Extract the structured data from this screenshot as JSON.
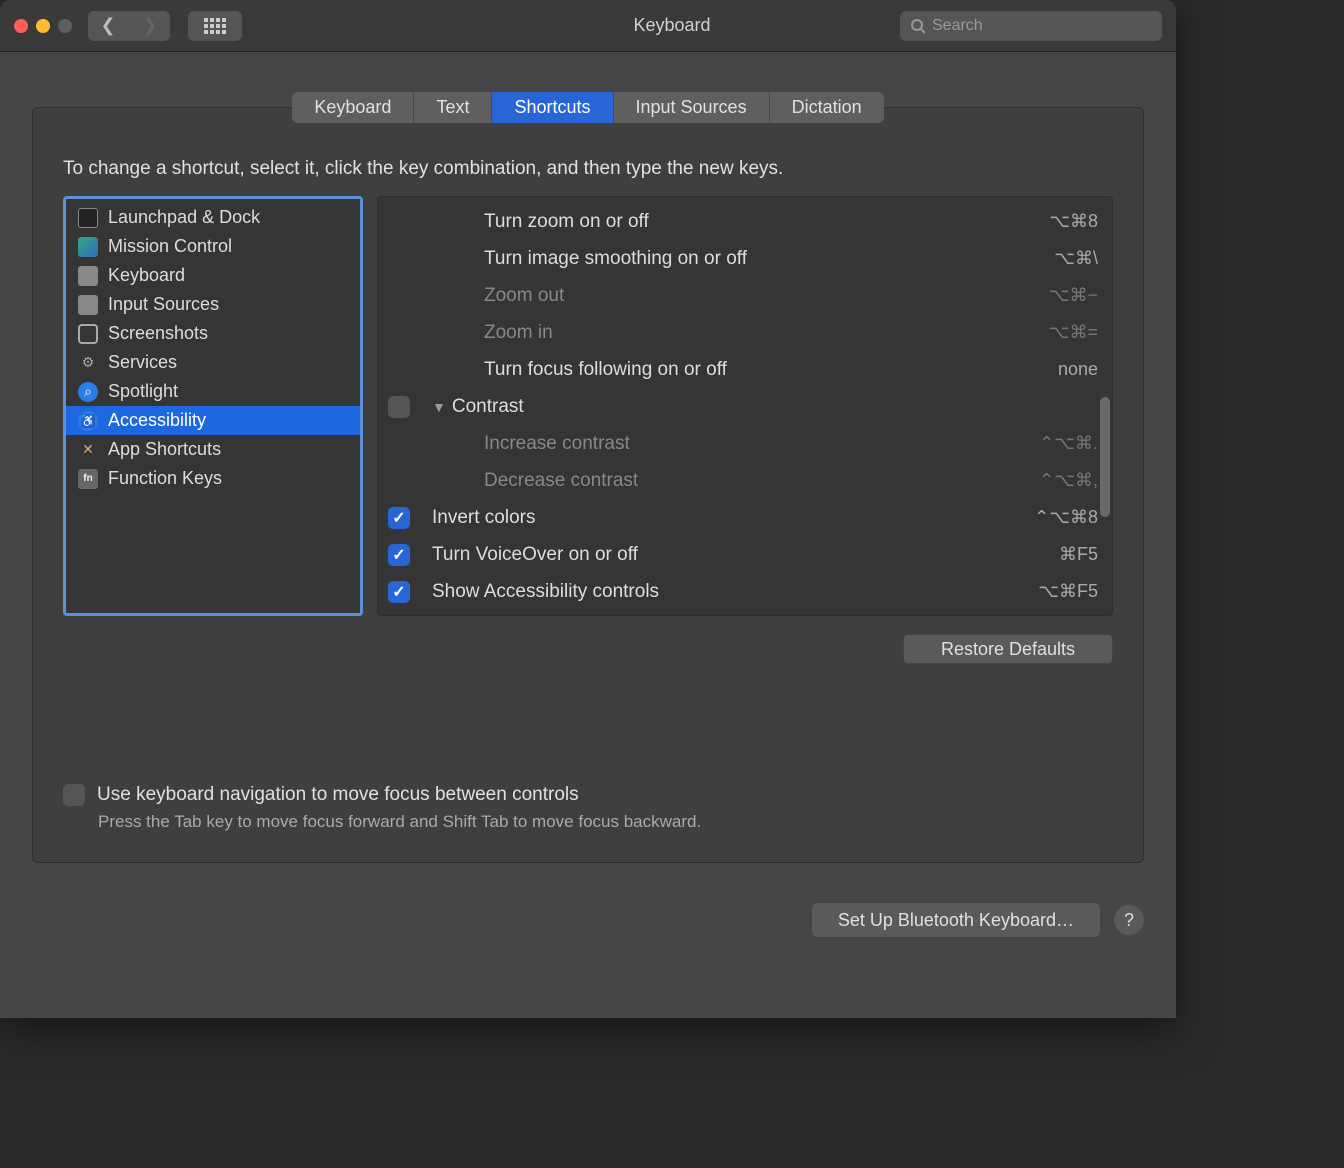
{
  "titlebar": {
    "title": "Keyboard",
    "search_placeholder": "Search"
  },
  "tabs": [
    "Keyboard",
    "Text",
    "Shortcuts",
    "Input Sources",
    "Dictation"
  ],
  "active_tab_index": 2,
  "instruction": "To change a shortcut, select it, click the key combination, and then type the new keys.",
  "sidebar": {
    "items": [
      {
        "label": "Launchpad & Dock",
        "icon": "launchpad-icon"
      },
      {
        "label": "Mission Control",
        "icon": "mission-control-icon"
      },
      {
        "label": "Keyboard",
        "icon": "keyboard-icon"
      },
      {
        "label": "Input Sources",
        "icon": "keyboard-icon"
      },
      {
        "label": "Screenshots",
        "icon": "camera-icon"
      },
      {
        "label": "Services",
        "icon": "gear-icon"
      },
      {
        "label": "Spotlight",
        "icon": "search-icon"
      },
      {
        "label": "Accessibility",
        "icon": "accessibility-icon"
      },
      {
        "label": "App Shortcuts",
        "icon": "apps-icon"
      },
      {
        "label": "Function Keys",
        "icon": "fn-icon"
      }
    ],
    "selected_index": 7
  },
  "shortcuts": [
    {
      "type": "item",
      "indent": 2,
      "checked": null,
      "label": "Turn zoom on or off",
      "key": "⌥⌘8",
      "dim": false
    },
    {
      "type": "item",
      "indent": 2,
      "checked": null,
      "label": "Turn image smoothing on or off",
      "key": "⌥⌘\\",
      "dim": false
    },
    {
      "type": "item",
      "indent": 2,
      "checked": null,
      "label": "Zoom out",
      "key": "⌥⌘−",
      "dim": true
    },
    {
      "type": "item",
      "indent": 2,
      "checked": null,
      "label": "Zoom in",
      "key": "⌥⌘=",
      "dim": true
    },
    {
      "type": "item",
      "indent": 2,
      "checked": null,
      "label": "Turn focus following on or off",
      "key": "none",
      "dim": false
    },
    {
      "type": "group",
      "indent": 1,
      "checked": false,
      "label": "Contrast",
      "key": "",
      "dim": false
    },
    {
      "type": "item",
      "indent": 2,
      "checked": null,
      "label": "Increase contrast",
      "key": "⌃⌥⌘.",
      "dim": true
    },
    {
      "type": "item",
      "indent": 2,
      "checked": null,
      "label": "Decrease contrast",
      "key": "⌃⌥⌘,",
      "dim": true
    },
    {
      "type": "item",
      "indent": 1,
      "checked": true,
      "label": "Invert colors",
      "key": "⌃⌥⌘8",
      "dim": false
    },
    {
      "type": "item",
      "indent": 1,
      "checked": true,
      "label": "Turn VoiceOver on or off",
      "key": "⌘F5",
      "dim": false
    },
    {
      "type": "item",
      "indent": 1,
      "checked": true,
      "label": "Show Accessibility controls",
      "key": "⌥⌘F5",
      "dim": false
    }
  ],
  "restore_label": "Restore Defaults",
  "kbnav": {
    "label": "Use keyboard navigation to move focus between controls",
    "sub": "Press the Tab key to move focus forward and Shift Tab to move focus backward."
  },
  "footer": {
    "bluetooth": "Set Up Bluetooth Keyboard…",
    "help": "?"
  }
}
